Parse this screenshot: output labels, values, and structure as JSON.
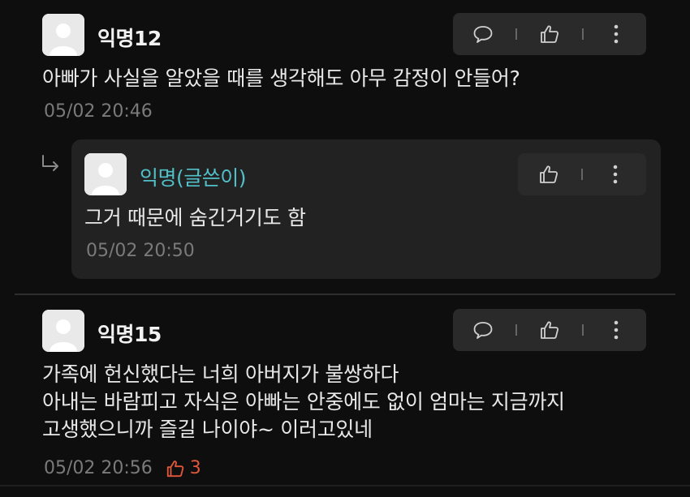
{
  "comments": [
    {
      "author": "익명12",
      "text": "아빠가 사실을 알았을 때를 생각해도 아무 감정이 안들어?",
      "timestamp": "05/02 20:46",
      "actions": [
        "comment-icon",
        "thumbs-up-icon",
        "more-vertical-icon"
      ]
    },
    {
      "author": "익명15",
      "text": "가족에 헌신했다는 너희 아버지가 불쌍하다\n아내는 바람피고 자식은 아빠는 안중에도 없이 엄마는 지금까지\n고생했으니까 즐길 나이야~ 이러고있네",
      "timestamp": "05/02 20:56",
      "likes": "3",
      "actions": [
        "comment-icon",
        "thumbs-up-icon",
        "more-vertical-icon"
      ]
    }
  ],
  "reply": {
    "author": "익명(글쓴이)",
    "text": "그거 때문에 숨긴거기도 함",
    "timestamp": "05/02 20:50",
    "actions": [
      "thumbs-up-icon",
      "more-vertical-icon"
    ]
  },
  "colors": {
    "background": "#0e0e0e",
    "card": "#222222",
    "op_author": "#52c0c9",
    "like_accent": "#e0573c",
    "meta_text": "#7a7a7a"
  }
}
